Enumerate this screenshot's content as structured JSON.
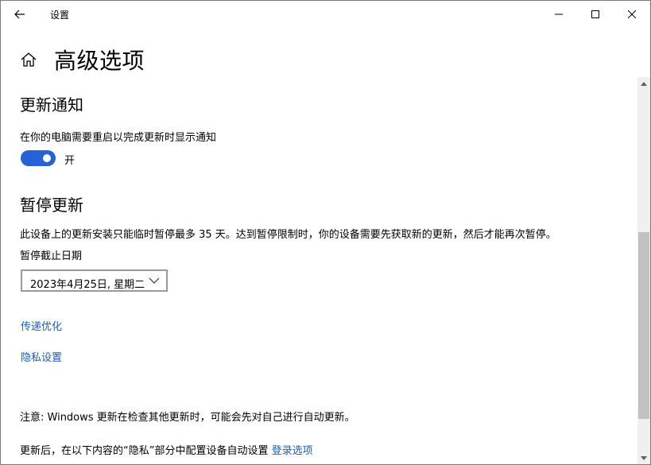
{
  "window": {
    "title": "设置"
  },
  "page": {
    "title": "高级选项"
  },
  "update_notification": {
    "heading": "更新通知",
    "description": "在你的电脑需要重启以完成更新时显示通知",
    "toggle_state": "开",
    "toggle_on": true
  },
  "pause_updates": {
    "heading": "暂停更新",
    "description": "此设备上的更新安装只能临时暂停最多 35 天。达到暂停限制时，你的设备需要先获取新的更新，然后才能再次暂停。",
    "date_label": "暂停截止日期",
    "date_value": "2023年4月25日, 星期二"
  },
  "links": {
    "delivery_optimization": "传递优化",
    "privacy_settings": "隐私设置"
  },
  "footer": {
    "note": "注意: Windows 更新在检查其他更新时，可能会先对自己进行自动更新。",
    "privacy_note": "更新后，在以下内容的“隐私”部分中配置设备自动设置",
    "sign_in_options": "登录选项"
  },
  "colors": {
    "accent": "#2462d6",
    "link": "#1a5fb4"
  },
  "icons": {
    "back": "back-arrow-icon",
    "minimize": "minimize-icon",
    "maximize": "maximize-icon",
    "close": "close-icon",
    "home": "home-icon",
    "dropdown": "chevron-down-icon"
  }
}
